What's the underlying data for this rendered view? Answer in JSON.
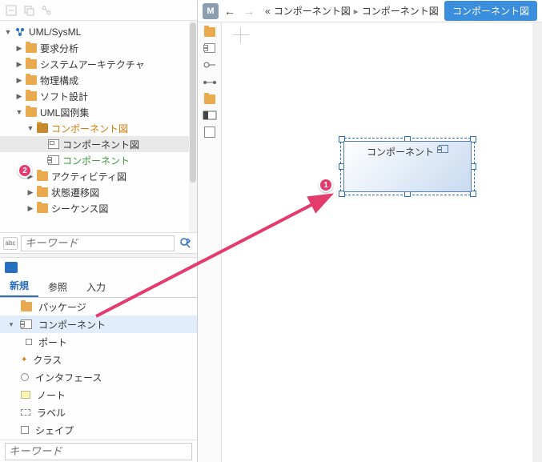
{
  "tree": {
    "root": "UML/SysML",
    "items": [
      {
        "label": "要求分析"
      },
      {
        "label": "システムアーキテクチャ"
      },
      {
        "label": "物理構成"
      },
      {
        "label": "ソフト設計"
      },
      {
        "label": "UML図例集",
        "children": [
          {
            "label": "コンポーネント図",
            "style": "orange",
            "children": [
              {
                "label": "コンポーネント図",
                "type": "diagram",
                "selected": true
              },
              {
                "label": "コンポーネント",
                "type": "component",
                "style": "green"
              }
            ]
          },
          {
            "label": "アクティビティ図"
          },
          {
            "label": "状態遷移図"
          },
          {
            "label": "シーケンス図"
          }
        ]
      }
    ]
  },
  "search": {
    "placeholder": "キーワード",
    "small_label": "abc"
  },
  "tabs": {
    "t1": "新規",
    "t2": "参照",
    "t3": "入力"
  },
  "palette": {
    "package": "パッケージ",
    "component": "コンポーネント",
    "port": "ポート",
    "class": "クラス",
    "interface": "インタフェース",
    "note": "ノート",
    "label": "ラベル",
    "shape": "シェイプ"
  },
  "bottom_search": {
    "placeholder": "キーワード"
  },
  "canvas_toolbar": {
    "m": "M",
    "breadcrumb_prefix": "«",
    "breadcrumb1": "コンポーネント図",
    "breadcrumb_sep": "▸",
    "breadcrumb2": "コンポーネント図",
    "button": "コンポーネント図"
  },
  "canvas_component": {
    "title": "コンポーネント"
  },
  "badges": {
    "b1": "1",
    "b2": "2"
  }
}
